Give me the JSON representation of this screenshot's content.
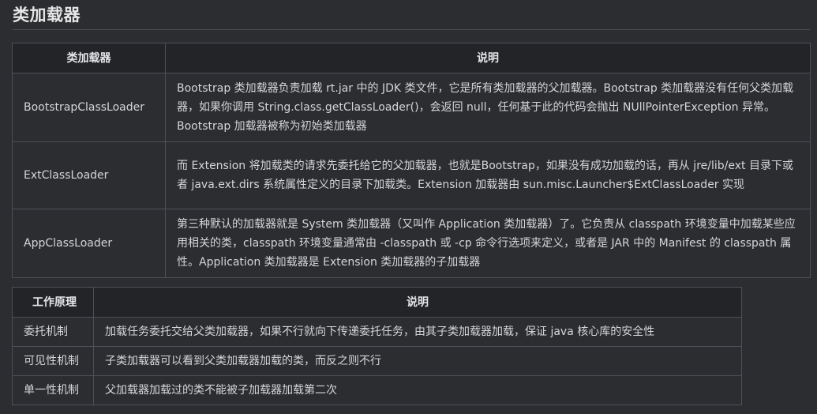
{
  "title": "类加载器",
  "loaders_table": {
    "headers": [
      "类加载器",
      "说明"
    ],
    "rows": [
      {
        "name": "BootstrapClassLoader",
        "desc": "Bootstrap 类加载器负责加载 rt.jar 中的 JDK 类文件，它是所有类加载器的父加载器。Bootstrap 类加载器没有任何父类加载器，如果你调用 String.class.getClassLoader()，会返回 null，任何基于此的代码会抛出 NUllPointerException 异常。Bootstrap 加载器被称为初始类加载器"
      },
      {
        "name": "ExtClassLoader",
        "desc": "而 Extension 将加载类的请求先委托给它的父加载器，也就是Bootstrap，如果没有成功加载的话，再从 jre/lib/ext 目录下或者 java.ext.dirs 系统属性定义的目录下加载类。Extension 加载器由 sun.misc.Launcher$ExtClassLoader 实现"
      },
      {
        "name": "AppClassLoader",
        "desc": "第三种默认的加载器就是 System 类加载器（又叫作 Application 类加载器）了。它负责从 classpath 环境变量中加载某些应用相关的类，classpath 环境变量通常由 -classpath 或 -cp 命令行选项来定义，或者是 JAR 中的 Manifest 的 classpath 属性。Application 类加载器是 Extension 类加载器的子加载器"
      }
    ]
  },
  "principles_table": {
    "headers": [
      "工作原理",
      "说明"
    ],
    "rows": [
      {
        "name": "委托机制",
        "desc": "加载任务委托交给父类加载器，如果不行就向下传递委托任务，由其子类加载器加载，保证 java 核心库的安全性"
      },
      {
        "name": "可见性机制",
        "desc": "子类加载器可以看到父类加载器加载的类，而反之则不行"
      },
      {
        "name": "单一性机制",
        "desc": "父加载器加载过的类不能被子加载器加载第二次"
      }
    ]
  }
}
